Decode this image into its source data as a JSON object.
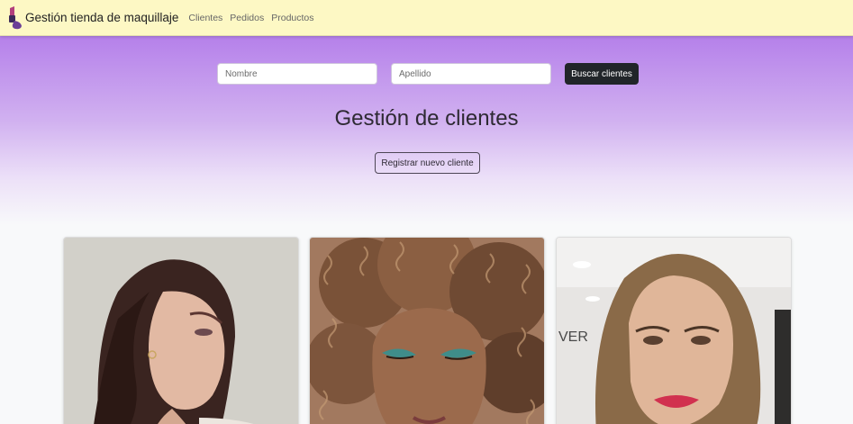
{
  "navbar": {
    "brand": "Gestión tienda de maquillaje",
    "links": [
      "Clientes",
      "Pedidos",
      "Productos"
    ]
  },
  "search": {
    "first_name_placeholder": "Nombre",
    "last_name_placeholder": "Apellido",
    "button_label": "Buscar clientes"
  },
  "hero": {
    "title": "Gestión de clientes",
    "register_button": "Registrar nuevo cliente"
  },
  "colors": {
    "navbar_bg": "#fdf8c4",
    "hero_gradient_top": "#b580ea",
    "button_dark": "#212529"
  },
  "icons": {
    "brand": "lipstick-icon"
  },
  "cards": [
    {
      "photo": "woman-dark-hair-side-profile-photo"
    },
    {
      "photo": "woman-curly-hair-teal-eyeshadow-photo"
    },
    {
      "photo": "woman-red-lipstick-selfie-photo"
    }
  ]
}
